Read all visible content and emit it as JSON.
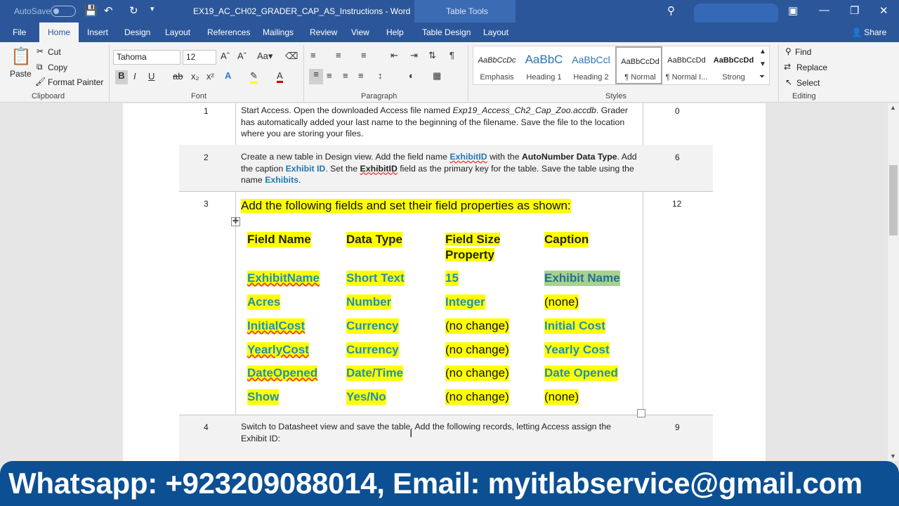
{
  "titlebar": {
    "autosave": "AutoSave",
    "doc_title": "EX19_AC_CH02_GRADER_CAP_AS_Instructions  -  Word",
    "table_tools": "Table Tools",
    "share": "Share"
  },
  "tabs": [
    "File",
    "Home",
    "Insert",
    "Design",
    "Layout",
    "References",
    "Mailings",
    "Review",
    "View",
    "Help",
    "Table Design",
    "Layout"
  ],
  "clipboard": {
    "paste": "Paste",
    "cut": "Cut",
    "copy": "Copy",
    "format_painter": "Format Painter",
    "group": "Clipboard"
  },
  "font": {
    "name": "Tahoma",
    "size": "12",
    "group": "Font"
  },
  "paragraph": {
    "group": "Paragraph"
  },
  "styles": {
    "group": "Styles",
    "items": [
      {
        "preview": "AaBbCcDc",
        "label": "Emphasis"
      },
      {
        "preview": "AaBbC",
        "label": "Heading 1"
      },
      {
        "preview": "AaBbCcl",
        "label": "Heading 2"
      },
      {
        "preview": "AaBbCcDd",
        "label": "¶ Normal"
      },
      {
        "preview": "AaBbCcDd",
        "label": "¶ Normal I..."
      },
      {
        "preview": "AaBbCcDd",
        "label": "Strong"
      }
    ]
  },
  "editing": {
    "find": "Find",
    "replace": "Replace",
    "select": "Select",
    "group": "Editing"
  },
  "steps": [
    {
      "num": "1",
      "points": "0"
    },
    {
      "num": "2",
      "points": "6"
    },
    {
      "num": "3",
      "points": "12",
      "text": "Add the following fields and set their field properties as shown:"
    },
    {
      "num": "4",
      "points": "9",
      "text": "Switch to Datasheet view and save the table. Add the following records, letting Access assign the Exhibit ID:"
    }
  ],
  "step1": {
    "a": "Start Access. Open the downloaded Access file named ",
    "file": "Exp19_Access_Ch2_Cap_Zoo.accdb",
    "b": ". Grader has automatically added your last name to the beginning of the filename. Save the file to the location where you are storing your files."
  },
  "step2": {
    "a": "Create a new table in Design view. Add the field name ",
    "f1": "ExhibitID",
    "b": " with the ",
    "f2": "AutoNumber Data Type",
    "c": ". Add the caption ",
    "f3": "Exhibit ID",
    "d": ". Set the ",
    "f4": "ExhibitID",
    "e": " field as the primary key for the table. Save the table using the name ",
    "f5": "Exhibits",
    "g": "."
  },
  "field_table": {
    "headers": [
      "Field Name",
      "Data Type",
      "Field Size Property",
      "Caption"
    ],
    "rows": [
      [
        "ExhibitName",
        "Short Text",
        "15",
        "Exhibit Name"
      ],
      [
        "Acres",
        "Number",
        "Integer",
        "(none)"
      ],
      [
        "InitialCost",
        "Currency",
        "(no change)",
        "Initial Cost"
      ],
      [
        "YearlyCost",
        "Currency",
        "(no change)",
        "Yearly Cost"
      ],
      [
        "DateOpened",
        "Date/Time",
        "(no change)",
        "Date Opened"
      ],
      [
        "Show",
        "Yes/No",
        "(no change)",
        "(none)"
      ]
    ]
  },
  "banner": "Whatsapp: +923209088014, Email: myitlabservice@gmail.com",
  "colors": {
    "word_blue": "#2b579a",
    "highlight": "#ffff00",
    "field_blue": "#1f8fb8",
    "banner": "#0c4f92"
  }
}
